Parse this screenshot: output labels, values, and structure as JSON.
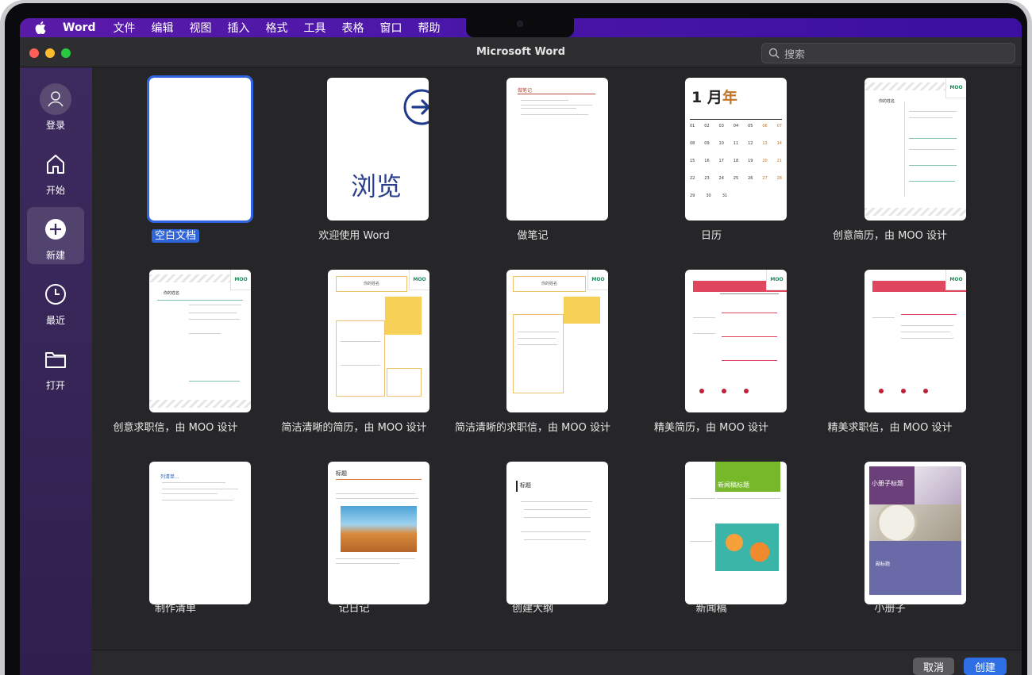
{
  "menubar": {
    "app_name": "Word",
    "items": [
      "文件",
      "编辑",
      "视图",
      "插入",
      "格式",
      "工具",
      "表格",
      "窗口",
      "帮助"
    ]
  },
  "window": {
    "title": "Microsoft Word",
    "search_placeholder": "搜索"
  },
  "sidebar": {
    "items": [
      {
        "label": "登录",
        "icon": "person-icon"
      },
      {
        "label": "开始",
        "icon": "home-icon"
      },
      {
        "label": "新建",
        "icon": "plus-circle-icon",
        "active": true
      },
      {
        "label": "最近",
        "icon": "clock-icon"
      },
      {
        "label": "打开",
        "icon": "folder-icon"
      }
    ]
  },
  "templates": [
    {
      "label": "空白文档",
      "selected": true
    },
    {
      "label": "欢迎使用 Word",
      "thumb_text": "浏览"
    },
    {
      "label": "做笔记",
      "thumb_text": "做笔记"
    },
    {
      "label": "日历",
      "thumb_text": "1 月年"
    },
    {
      "label": "创意简历，由 MOO 设计"
    },
    {
      "label": "创意求职信，由 MOO 设计"
    },
    {
      "label": "简洁清晰的简历，由 MOO 设计"
    },
    {
      "label": "简洁清晰的求职信，由 MOO 设计"
    },
    {
      "label": "精美简历，由 MOO 设计"
    },
    {
      "label": "精美求职信，由 MOO 设计"
    },
    {
      "label": "制作清单",
      "thumb_text": "列清单..."
    },
    {
      "label": "记日记",
      "thumb_text": "标题"
    },
    {
      "label": "创建大纲",
      "thumb_text": "标题"
    },
    {
      "label": "新闻稿",
      "thumb_text": "新闻稿标题"
    },
    {
      "label": "小册子",
      "thumb_text": "小册子标题"
    }
  ],
  "calendar": {
    "month": "1 月",
    "year_suffix": "年",
    "rows": [
      [
        "01",
        "02",
        "03",
        "04",
        "05",
        "06",
        "07"
      ],
      [
        "08",
        "09",
        "10",
        "11",
        "12",
        "13",
        "14"
      ],
      [
        "15",
        "16",
        "17",
        "18",
        "19",
        "20",
        "21"
      ],
      [
        "22",
        "23",
        "24",
        "25",
        "26",
        "27",
        "28"
      ],
      [
        "29",
        "30",
        "31",
        "",
        "",
        "",
        ""
      ]
    ]
  },
  "moo_badge": "MOO",
  "resume_name": "你的姓名",
  "brochure_sub": "副标题",
  "buttons": {
    "cancel": "取消",
    "create": "创建"
  },
  "colors": {
    "accent": "#2f6fe6",
    "sidebar": "#3d2b5f",
    "menubar": "#4b17a8"
  }
}
